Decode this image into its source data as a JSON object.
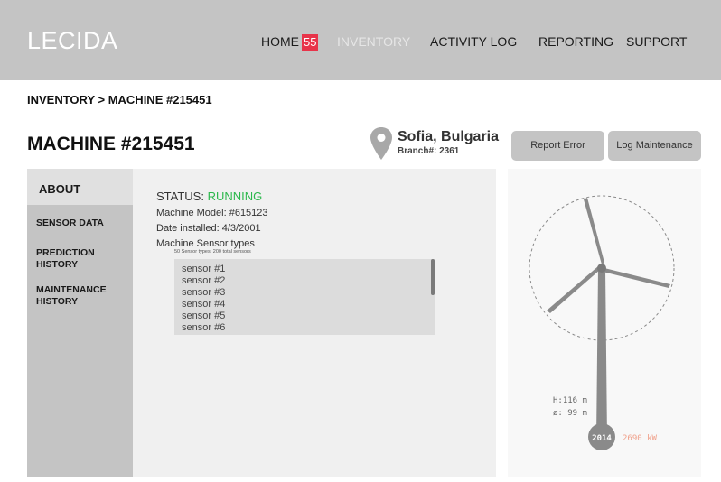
{
  "header": {
    "logo": "LECIDA",
    "nav": [
      {
        "label": "HOME",
        "badge": "55"
      },
      {
        "label": "INVENTORY"
      },
      {
        "label": "ACTIVITY LOG"
      },
      {
        "label": "REPORTING"
      },
      {
        "label": "SUPPORT"
      }
    ]
  },
  "breadcrumb": "INVENTORY > MACHINE #215451",
  "page_title": "MACHINE #215451",
  "location": {
    "city": "Sofia, Bulgaria",
    "branch": "Branch#: 2361"
  },
  "buttons": {
    "report_error": "Report Error",
    "log_maintenance": "Log Maintenance"
  },
  "sidebar": {
    "active": "ABOUT",
    "items": [
      "SENSOR DATA",
      "PREDICTION HISTORY",
      "MAINTENANCE HISTORY"
    ]
  },
  "about": {
    "status_label": "STATUS: ",
    "status_value": "RUNNING",
    "model": "Machine Model: #615123",
    "installed": "Date installed: 4/3/2001",
    "sensor_types_label": "Machine Sensor types",
    "sensor_summary": "50 Sensor types, 200 total sensors",
    "sensors": [
      "sensor #1",
      "sensor #2",
      "sensor #3",
      "sensor #4",
      "sensor #5",
      "sensor #6"
    ]
  },
  "turbine": {
    "height": "H:116 m",
    "diameter": "ø: 99 m",
    "year": "2014",
    "power": "2690 kW"
  },
  "colors": {
    "header_bg": "#c4c4c4",
    "badge": "#e8344a",
    "status_running": "#2db84d",
    "power": "#f0a08a"
  }
}
